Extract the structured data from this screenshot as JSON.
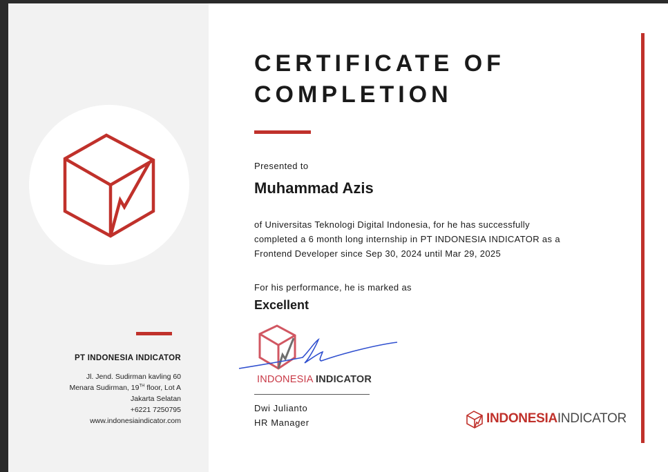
{
  "certificate": {
    "title_line1": "CERTIFICATE OF",
    "title_line2": "COMPLETION",
    "presented_label": "Presented to",
    "recipient": "Muhammad Azis",
    "description_lines": [
      "of Universitas Teknologi Digital Indonesia, for he has successfully",
      "completed a 6 month long internship in PT INDONESIA INDICATOR as a",
      "Frontend Developer since Sep 30, 2024 until Mar 29, 2025"
    ],
    "performance_label": "For his performance, he is marked as",
    "grade": "Excellent"
  },
  "signature": {
    "stamp_part1": "INDONESIA",
    "stamp_part2": "INDICATOR",
    "name": "Dwi Julianto",
    "role": "HR Manager"
  },
  "sidebar": {
    "company": "PT INDONESIA INDICATOR",
    "address_line1": "Jl. Jend. Sudirman kavling 60",
    "address_line2_pre": "Menara Sudirman, 19",
    "address_line2_sup": "TH",
    "address_line2_post": " floor, Lot A",
    "address_line3": "Jakarta Selatan",
    "phone": "+6221 7250795",
    "website": "www.indonesiaindicator.com"
  },
  "footer_logo": {
    "part1": "INDONESIA",
    "part2": "INDICATOR"
  },
  "colors": {
    "accent": "#c0312b",
    "sidebar_bg": "#f2f2f2",
    "signature_ink": "#2f4fcf"
  }
}
